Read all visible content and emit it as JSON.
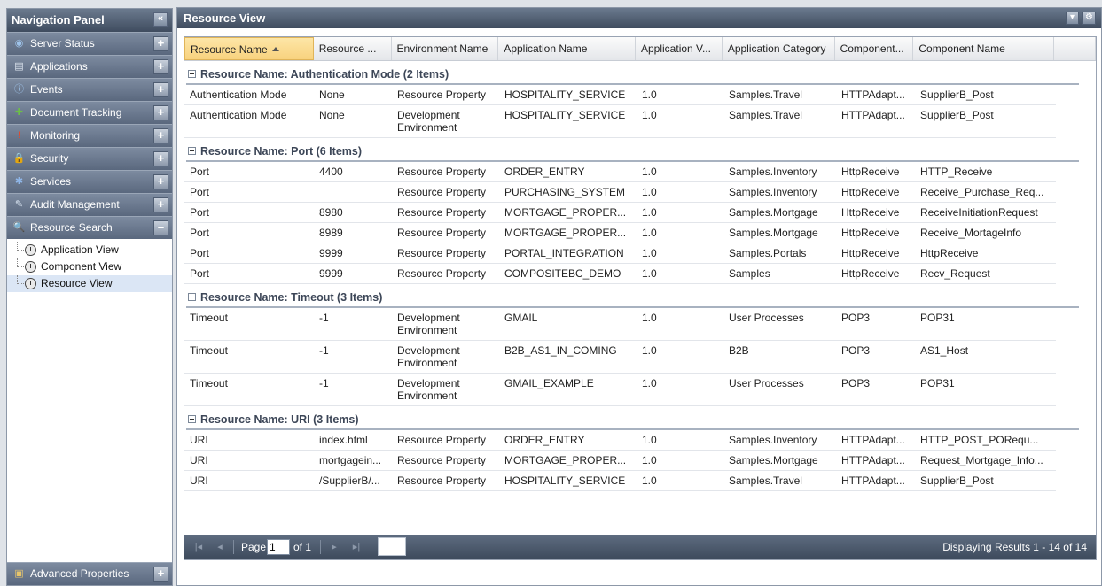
{
  "nav": {
    "title": "Navigation Panel",
    "collapse_glyph": "«",
    "items": [
      {
        "label": "Server Status",
        "icon": "server-icon",
        "glyph": "◉",
        "color": "#9ec3ea",
        "btn": "+"
      },
      {
        "label": "Applications",
        "icon": "applications-icon",
        "glyph": "▤",
        "color": "#dfe7f1",
        "btn": "+"
      },
      {
        "label": "Events",
        "icon": "events-icon",
        "glyph": "ⓘ",
        "color": "#9ec3ea",
        "btn": "+"
      },
      {
        "label": "Document Tracking",
        "icon": "puzzle-icon",
        "glyph": "✚",
        "color": "#6cbf48",
        "btn": "+"
      },
      {
        "label": "Monitoring",
        "icon": "monitoring-icon",
        "glyph": "!",
        "color": "#e24a2d",
        "btn": "+"
      },
      {
        "label": "Security",
        "icon": "lock-icon",
        "glyph": "🔒",
        "color": "#f4c23b",
        "btn": "+"
      },
      {
        "label": "Services",
        "icon": "services-icon",
        "glyph": "✱",
        "color": "#8fb6e8",
        "btn": "+"
      },
      {
        "label": "Audit Management",
        "icon": "audit-icon",
        "glyph": "✎",
        "color": "#d9e4f1",
        "btn": "+"
      },
      {
        "label": "Resource Search",
        "icon": "search-icon",
        "glyph": "🔍",
        "color": "#d9e4f1",
        "btn": "–"
      }
    ],
    "subitems": [
      {
        "label": "Application View",
        "selected": false
      },
      {
        "label": "Component View",
        "selected": false
      },
      {
        "label": "Resource View",
        "selected": true
      }
    ],
    "advanced": {
      "label": "Advanced Properties",
      "glyph": "▣",
      "btn": "+"
    }
  },
  "main": {
    "title": "Resource View",
    "header_btn_glyphs": [
      "▾",
      "⚙"
    ],
    "columns": [
      "Resource Name",
      "Resource ...",
      "Environment Name",
      "Application Name",
      "Application V...",
      "Application Category",
      "Component...",
      "Component Name"
    ],
    "groups": [
      {
        "title": "Resource Name: Authentication Mode (2 Items)",
        "rows": [
          [
            "Authentication Mode",
            "None",
            "Resource Property",
            "HOSPITALITY_SERVICE",
            "1.0",
            "Samples.Travel",
            "HTTPAdapt...",
            "SupplierB_Post"
          ],
          [
            "Authentication Mode",
            "None",
            "Development Environment",
            "HOSPITALITY_SERVICE",
            "1.0",
            "Samples.Travel",
            "HTTPAdapt...",
            "SupplierB_Post"
          ]
        ]
      },
      {
        "title": "Resource Name: Port (6 Items)",
        "rows": [
          [
            "Port",
            "4400",
            "Resource Property",
            "ORDER_ENTRY",
            "1.0",
            "Samples.Inventory",
            "HttpReceive",
            "HTTP_Receive"
          ],
          [
            "Port",
            "",
            "Resource Property",
            "PURCHASING_SYSTEM",
            "1.0",
            "Samples.Inventory",
            "HttpReceive",
            "Receive_Purchase_Req..."
          ],
          [
            "Port",
            "8980",
            "Resource Property",
            "MORTGAGE_PROPER...",
            "1.0",
            "Samples.Mortgage",
            "HttpReceive",
            "ReceiveInitiationRequest"
          ],
          [
            "Port",
            "8989",
            "Resource Property",
            "MORTGAGE_PROPER...",
            "1.0",
            "Samples.Mortgage",
            "HttpReceive",
            "Receive_MortageInfo"
          ],
          [
            "Port",
            "9999",
            "Resource Property",
            "PORTAL_INTEGRATION",
            "1.0",
            "Samples.Portals",
            "HttpReceive",
            "HttpReceive"
          ],
          [
            "Port",
            "9999",
            "Resource Property",
            "COMPOSITEBC_DEMO",
            "1.0",
            "Samples",
            "HttpReceive",
            "Recv_Request"
          ]
        ]
      },
      {
        "title": "Resource Name: Timeout (3 Items)",
        "rows": [
          [
            "Timeout",
            "-1",
            "Development Environment",
            "GMAIL",
            "1.0",
            "User Processes",
            "POP3",
            "POP31"
          ],
          [
            "Timeout",
            "-1",
            "Development Environment",
            "B2B_AS1_IN_COMING",
            "1.0",
            "B2B",
            "POP3",
            "AS1_Host"
          ],
          [
            "Timeout",
            "-1",
            "Development Environment",
            "GMAIL_EXAMPLE",
            "1.0",
            "User Processes",
            "POP3",
            "POP31"
          ]
        ]
      },
      {
        "title": "Resource Name: URI (3 Items)",
        "rows": [
          [
            "URI",
            "index.html",
            "Resource Property",
            "ORDER_ENTRY",
            "1.0",
            "Samples.Inventory",
            "HTTPAdapt...",
            "HTTP_POST_PORequ..."
          ],
          [
            "URI",
            "mortgagein...",
            "Resource Property",
            "MORTGAGE_PROPER...",
            "1.0",
            "Samples.Mortgage",
            "HTTPAdapt...",
            "Request_Mortgage_Info..."
          ],
          [
            "URI",
            "/SupplierB/...",
            "Resource Property",
            "HOSPITALITY_SERVICE",
            "1.0",
            "Samples.Travel",
            "HTTPAdapt...",
            "SupplierB_Post"
          ]
        ]
      }
    ],
    "pager": {
      "page_label": "Page",
      "page_value": "1",
      "of_label": "of 1",
      "display": "Displaying Results 1 - 14 of 14",
      "first_glyph": "|◂",
      "prev_glyph": "◂",
      "next_glyph": "▸",
      "last_glyph": "▸|"
    }
  }
}
